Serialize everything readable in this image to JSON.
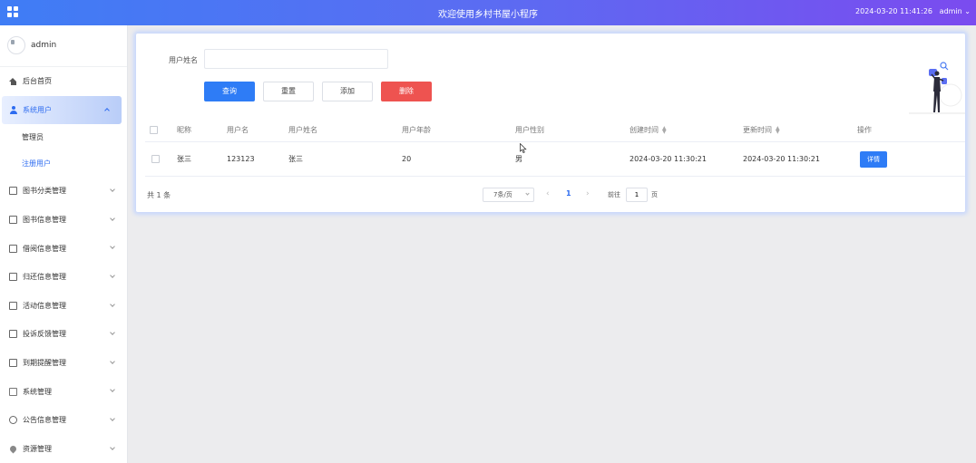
{
  "header": {
    "title": "欢迎使用乡村书屋小程序",
    "datetime": "2024-03-20 11:41:26",
    "user": "admin",
    "colors": {
      "gradient_start": "#3f7df5",
      "gradient_end": "#7b4bef"
    }
  },
  "sidebar": {
    "username": "admin",
    "items": [
      {
        "label": "后台首页",
        "icon": "home-icon"
      },
      {
        "label": "系统用户",
        "icon": "user-icon",
        "expanded": true,
        "children": [
          {
            "label": "管理员"
          },
          {
            "label": "注册用户",
            "active": true
          }
        ]
      },
      {
        "label": "图书分类管理",
        "icon": "document-icon"
      },
      {
        "label": "图书信息管理",
        "icon": "document-icon"
      },
      {
        "label": "借阅信息管理",
        "icon": "document-icon"
      },
      {
        "label": "归还信息管理",
        "icon": "document-icon"
      },
      {
        "label": "活动信息管理",
        "icon": "document-icon"
      },
      {
        "label": "投诉反馈管理",
        "icon": "document-icon"
      },
      {
        "label": "到期提醒管理",
        "icon": "document-icon"
      },
      {
        "label": "系统管理",
        "icon": "chart-icon"
      },
      {
        "label": "公告信息管理",
        "icon": "info-icon"
      },
      {
        "label": "资源管理",
        "icon": "location-icon"
      }
    ]
  },
  "search": {
    "label": "用户姓名",
    "value": "",
    "placeholder": ""
  },
  "toolbar": {
    "query": "查询",
    "reset": "重置",
    "add": "添加",
    "delete": "删除"
  },
  "table": {
    "headers": {
      "nickname": "昵称",
      "username": "用户名",
      "realname": "用户姓名",
      "age": "用户年龄",
      "gender": "用户性别",
      "created": "创建时间",
      "updated": "更新时间",
      "actions": "操作"
    },
    "rows": [
      {
        "nickname": "张三",
        "username": "123123",
        "realname": "张三",
        "age": "20",
        "gender": "男",
        "created": "2024-03-20 11:30:21",
        "updated": "2024-03-20 11:30:21",
        "action": "详情"
      }
    ]
  },
  "pagination": {
    "total": "共 1 条",
    "page_size": "7条/页",
    "current_page": "1",
    "goto_label": "前往",
    "goto_value": "1",
    "goto_suffix": "页"
  }
}
